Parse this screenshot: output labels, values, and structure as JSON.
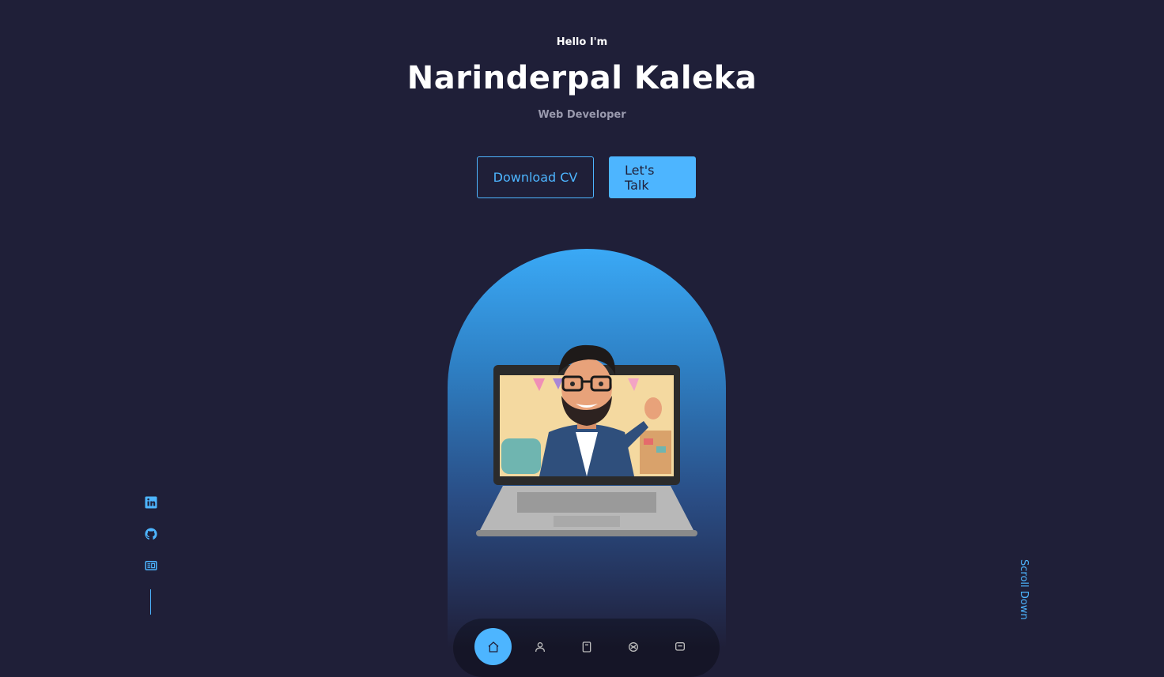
{
  "header": {
    "greeting": "Hello I'm",
    "name": "Narinderpal Kaleka",
    "role": "Web Developer"
  },
  "cta": {
    "download_label": "Download CV",
    "talk_label": "Let's Talk"
  },
  "socials": [
    {
      "icon": "linkedin-icon"
    },
    {
      "icon": "github-icon"
    },
    {
      "icon": "resume-icon"
    }
  ],
  "scroll": {
    "label": "Scroll Down"
  },
  "nav": [
    {
      "icon": "home-icon",
      "active": true
    },
    {
      "icon": "user-icon",
      "active": false
    },
    {
      "icon": "book-icon",
      "active": false
    },
    {
      "icon": "services-icon",
      "active": false
    },
    {
      "icon": "message-icon",
      "active": false
    }
  ],
  "colors": {
    "background": "#1f1f38",
    "accent": "#4db5ff",
    "muted_text": "#9a9aae"
  }
}
